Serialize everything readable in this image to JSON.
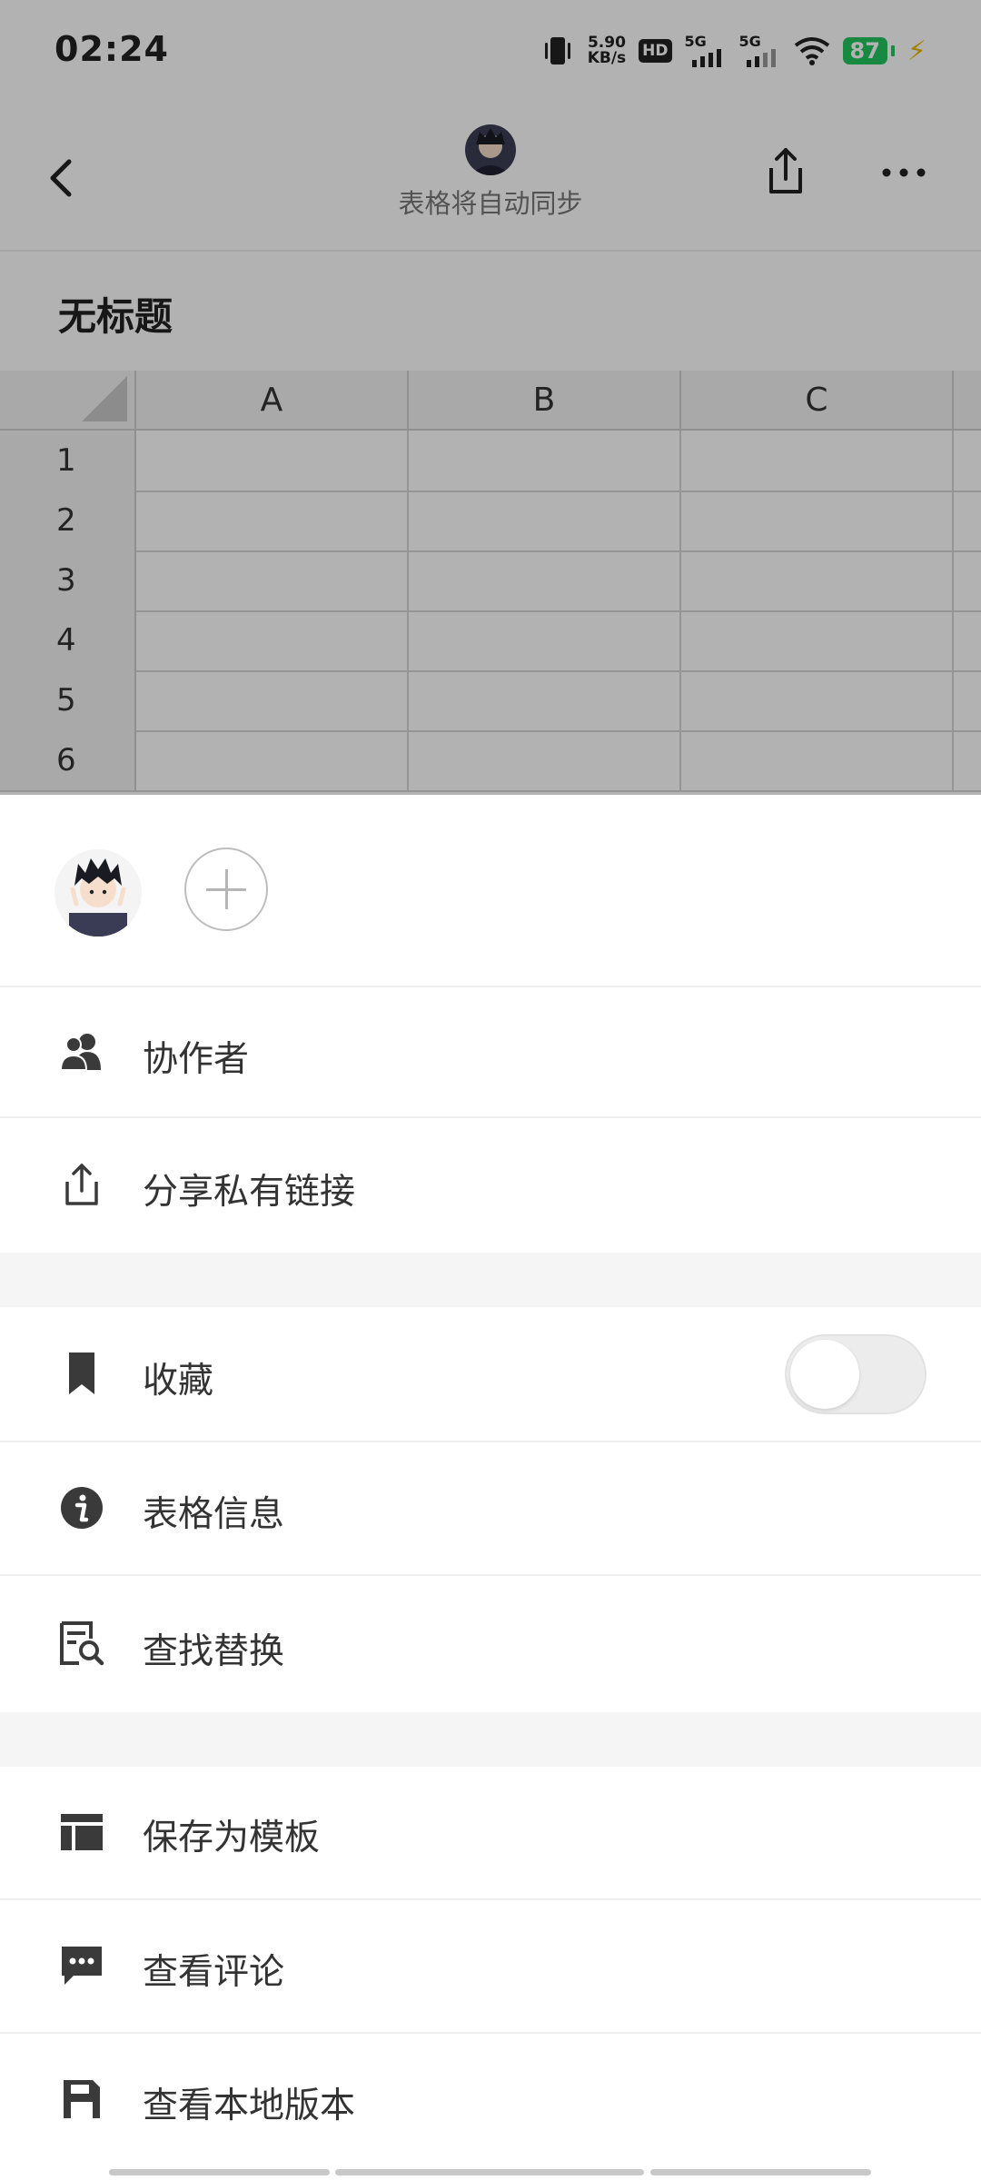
{
  "status_bar": {
    "time": "02:24",
    "net_speed_value": "5.90",
    "net_speed_unit": "KB/s",
    "hd_label": "HD",
    "sim1_label": "5G",
    "sim2_label": "5G",
    "battery": "87",
    "icons": [
      "vibrate-icon",
      "hd-voice-icon",
      "signal-5g-icon",
      "signal-5g-icon",
      "wifi-icon",
      "battery-icon",
      "charging-icon"
    ]
  },
  "header": {
    "sync_text": "表格将自动同步",
    "back_icon": "chevron-left-icon",
    "share_icon": "share-icon",
    "more_icon": "more-horizontal-icon"
  },
  "document": {
    "title": "无标题",
    "columns": [
      "A",
      "B",
      "C"
    ],
    "rows": [
      "1",
      "2",
      "3",
      "4",
      "5",
      "6"
    ]
  },
  "sheet": {
    "menu_groups": [
      [
        {
          "label": "协作者",
          "icon": "people-icon"
        },
        {
          "label": "分享私有链接",
          "icon": "share-icon"
        }
      ],
      [
        {
          "label": "收藏",
          "icon": "bookmark-icon",
          "toggle": false
        },
        {
          "label": "表格信息",
          "icon": "info-icon"
        },
        {
          "label": "查找替换",
          "icon": "find-replace-icon"
        }
      ],
      [
        {
          "label": "保存为模板",
          "icon": "template-icon"
        },
        {
          "label": "查看评论",
          "icon": "comment-icon"
        },
        {
          "label": "查看本地版本",
          "icon": "save-icon"
        }
      ]
    ]
  },
  "colors": {
    "icon": "#3a3a3a",
    "battery": "#22c55e",
    "overlay": "rgba(0,0,0,0.30)"
  }
}
